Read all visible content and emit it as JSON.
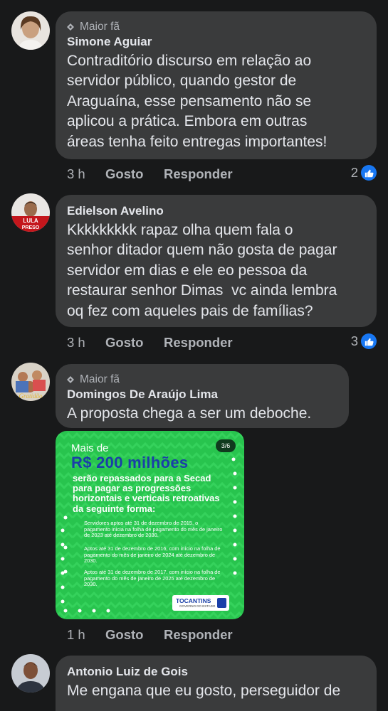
{
  "comments": [
    {
      "badge": "Maior fã",
      "author": "Simone Aguiar",
      "text": "Contraditório discurso em relação ao\nservidor público, quando gestor de\nAraguaína, esse pensamento não se\naplicou a prática. Embora em outras\náreas tenha feito entregas importantes!",
      "time": "3 h",
      "like": "Gosto",
      "reply": "Responder",
      "reactions": "2"
    },
    {
      "author": "Edielson Avelino",
      "text": "Kkkkkkkkk rapaz olha quem fala o\nsenhor ditador quem não gosta de pagar\nservidor em dias e ele eo pessoa da\nrestaurar senhor Dimas  vc ainda lembra\noq fez com aqueles pais de famílias?",
      "time": "3 h",
      "like": "Gosto",
      "reply": "Responder",
      "reactions": "3",
      "avatar_text": "LULA PRESO"
    },
    {
      "badge": "Maior fã",
      "author": "Domingos De Araújo Lima",
      "text": "A proposta chega a ser um deboche.",
      "time": "1 h",
      "like": "Gosto",
      "reply": "Responder",
      "image": {
        "pager": "3/6",
        "line1": "Mais de",
        "line2": "R$ 200 milhões",
        "line3": "serão repassados para a Secad para pagar as progressões horizontais e verticais retroativas da seguinte forma:",
        "item1": "Servidores aptos até 31 de dezembro de 2015, o pagamento inicia na folha de pagamento do mês de janeiro de 2023 até dezembro de 2030.",
        "item2": "Aptos até 31 de dezembro de 2016, com início na folha de pagamento do mês de janeiro de 2024 até dezembro de 2030.",
        "item3": "Aptos até 31 de dezembro de 2017, com início na folha de pagamento do mês de janeiro de 2025 até dezembro de 2030.",
        "logo": "TOCANTINS",
        "logo_sub": "GOVERNO DO ESTADO"
      }
    },
    {
      "author": "Antonio Luiz de Gois",
      "text": "Me engana que eu gosto, perseguidor de"
    }
  ],
  "colors": {
    "background": "#18191a",
    "bubble": "#3a3b3c",
    "primary_text": "#e4e6eb",
    "secondary_text": "#b0b3b8",
    "like_blue": "#1877f2",
    "image_green": "#28c44e"
  },
  "icons": [
    "fan-badge-icon",
    "like-thumb-icon"
  ]
}
